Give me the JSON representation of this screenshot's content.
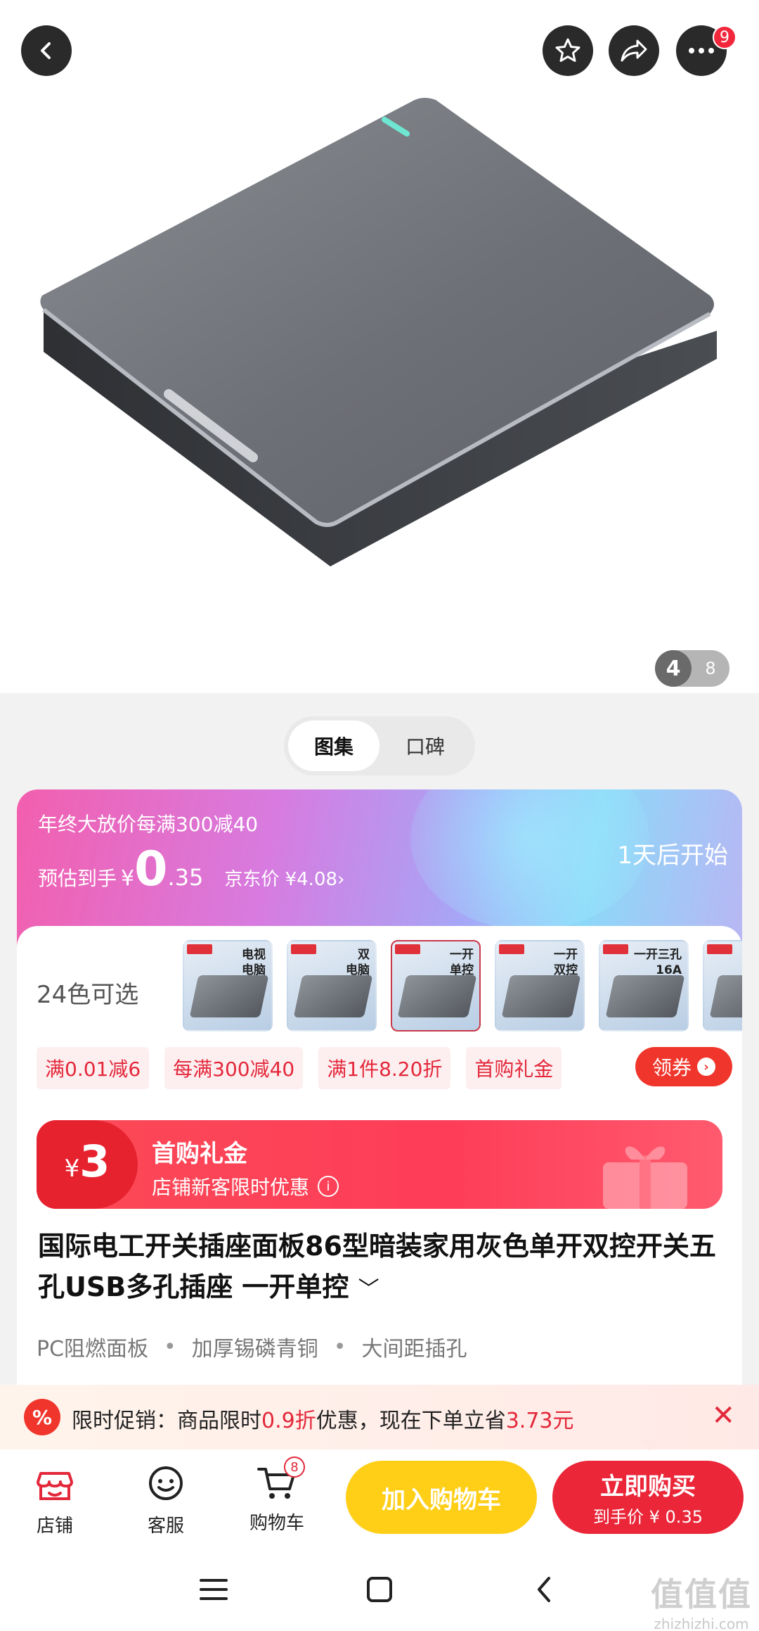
{
  "header": {
    "more_badge": "9"
  },
  "gallery": {
    "current": "4",
    "total": "8"
  },
  "tabs": [
    "图集",
    "口碑"
  ],
  "promo": {
    "title": "年终大放价每满300减40",
    "est_label": "预估到手",
    "currency": "¥",
    "price_int": "0",
    "price_dec": ".35",
    "jd_price": "京东价 ¥4.08›",
    "start_text": "1天后开始",
    "gradient_start": "#f25fae",
    "gradient_end": "#8cd8f8"
  },
  "variants": {
    "label": "24色可选",
    "items": [
      {
        "caption": "电视\n电脑"
      },
      {
        "caption": "双\n电脑"
      },
      {
        "caption": "一开\n单控"
      },
      {
        "caption": "一开\n双控"
      },
      {
        "caption": "一开三孔\n16A"
      },
      {
        "caption": ""
      }
    ]
  },
  "coupons": {
    "items": [
      "满0.01减6",
      "每满300减40",
      "满1件8.20折",
      "首购礼金"
    ],
    "action": "领券"
  },
  "gift": {
    "currency": "¥",
    "amount": "3",
    "title": "首购礼金",
    "subtitle": "店铺新客限时优惠",
    "info_icon": "i"
  },
  "product": {
    "title": "国际电工开关插座面板86型暗装家用灰色单开双控开关五孔USB多孔插座 一开单控",
    "title_chevron": "﹀",
    "tags": [
      "PC阻燃面板",
      "加厚锡磷青铜",
      "大间距插孔"
    ]
  },
  "flash": {
    "icon": "%",
    "prefix": "限时促销：商品限时",
    "discount": "0.9折",
    "middle": "优惠，现在下单立省",
    "save": "3.73元",
    "close": "✕"
  },
  "bottom_bar": {
    "store": "店铺",
    "service": "客服",
    "cart": "购物车",
    "cart_count": "8",
    "add_to_cart": "加入购物车",
    "buy_now": "立即购买",
    "buy_now_sub": "到手价 ¥ 0.35",
    "accent": "#ea2638",
    "cart_color": "#ffcf18"
  },
  "watermark": {
    "big": "值值值",
    "small": "zhizhizhi.com"
  }
}
